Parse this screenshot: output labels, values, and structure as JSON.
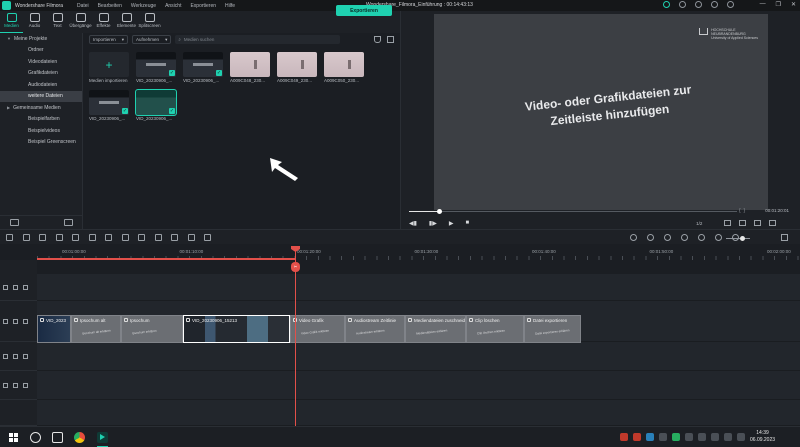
{
  "app": {
    "name": "Wondershare Filmora",
    "document_title": "Wondershare_Filmora_Einführung : 00:14:43:13",
    "menu": [
      "Datei",
      "Bearbeiten",
      "Werkzeuge",
      "Ansicht",
      "Exportieren",
      "Hilfe"
    ],
    "window_controls": [
      "—",
      "❐",
      "✕"
    ]
  },
  "toolbar": {
    "tools": [
      "Medien",
      "Audio",
      "Text",
      "Übergänge",
      "Effekte",
      "Elemente",
      "Splitscreen"
    ],
    "active_tool": "Medien",
    "export_label": "Exportieren"
  },
  "sidebar": {
    "items": [
      {
        "label": "Meine Projekte",
        "level": 0,
        "caret": "▼"
      },
      {
        "label": "Ordner",
        "level": 1
      },
      {
        "label": "Videodateien",
        "level": 1
      },
      {
        "label": "Grafikdateien",
        "level": 1
      },
      {
        "label": "Audiodateien",
        "level": 1
      },
      {
        "label": "weitere Dateien",
        "level": 1,
        "selected": true
      },
      {
        "label": "Gemeinsame Medien",
        "level": 0,
        "caret": "▶"
      },
      {
        "label": "Beispielfarben",
        "level": 1
      },
      {
        "label": "Beispielvideos",
        "level": 1
      },
      {
        "label": "Beispiel Greenscreen",
        "level": 1
      }
    ]
  },
  "media": {
    "import_dropdown": "Importieren",
    "record_dropdown": "Aufnehmen",
    "search_placeholder": "Medien suchen",
    "import_label": "Medien importieren",
    "items": [
      {
        "caption": "VID_20230906_...",
        "kind": "vid",
        "checked": true
      },
      {
        "caption": "VID_20230906_...",
        "kind": "vid",
        "checked": true
      },
      {
        "caption": "A009C048_230...",
        "kind": "img",
        "checked": false
      },
      {
        "caption": "A009C049_230...",
        "kind": "img",
        "checked": false
      },
      {
        "caption": "A009C050_230...",
        "kind": "img",
        "checked": false
      },
      {
        "caption": "VID_20230906_...",
        "kind": "vid",
        "checked": true
      },
      {
        "caption": "VID_20230906_...",
        "kind": "hover",
        "checked": true
      }
    ]
  },
  "preview": {
    "overlay_text": "Video- oder Grafikdateien zur Zeitleiste hinzufügen",
    "logo_text": "HOCHSCHULE\nNEUBRANDENBURG\nUniversity of Applied Sciences",
    "timecode": "00:01:20:01",
    "zoom": "1/2",
    "progress_fraction": 0.09
  },
  "timeline": {
    "ruler_labels": [
      "00:01:00:00",
      "00:01:10:00",
      "00:01:20:00",
      "00:01:30:00",
      "00:01:40:00",
      "00:01:50:00",
      "00:02:00:00"
    ],
    "clips": [
      {
        "title": "VID_2023",
        "subtitle": "",
        "style": "first"
      },
      {
        "title": "Ipsochum alt",
        "subtitle": "Ipsochum alt erklären",
        "style": "plain"
      },
      {
        "title": "Ipsochum",
        "subtitle": "Ipsochum erklären",
        "style": "plain"
      },
      {
        "title": "VID_20230906_15213",
        "subtitle": "",
        "style": "video"
      },
      {
        "title": "Video Grafik",
        "subtitle": "Video Grafik erklären",
        "style": "plain"
      },
      {
        "title": "Audiostream Zeitlinie",
        "subtitle": "Audiostream erklären",
        "style": "plain"
      },
      {
        "title": "Mediendateien zuschneiden",
        "subtitle": "Mediendateien erklären",
        "style": "plain"
      },
      {
        "title": "Clip löschen",
        "subtitle": "Clip löschen erklären",
        "style": "plain"
      },
      {
        "title": "Datei exportieren",
        "subtitle": "Datei exportieren erklären",
        "style": "plain"
      }
    ]
  },
  "taskbar": {
    "time": "14:39",
    "date": "06.09.2023"
  },
  "colors": {
    "accent": "#1fd1b0",
    "playhead": "#e2504a"
  }
}
